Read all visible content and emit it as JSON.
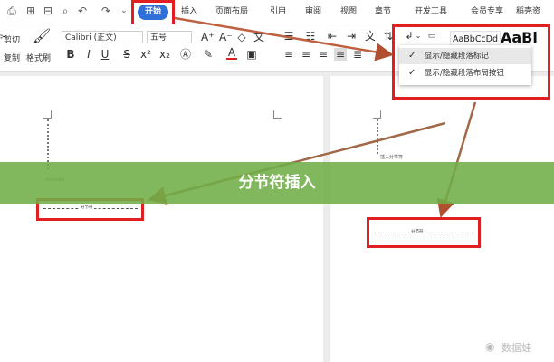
{
  "menu": {
    "home_tab": "开始",
    "tabs": [
      "插入",
      "页面布局",
      "引用",
      "审阅",
      "视图",
      "章节",
      "开发工具",
      "会员专享",
      "稻壳资"
    ]
  },
  "ribbon": {
    "cut": "剪切",
    "copy": "复制",
    "format_painter": "格式刷",
    "font_name": "Calibri (正文)",
    "font_size": "五号",
    "style_preview_1": "AaBbCcDd",
    "style_preview_2": "AaBl"
  },
  "dropdown": {
    "items": [
      "显示/隐藏段落标记",
      "显示/隐藏段落布局按钮"
    ]
  },
  "banner": {
    "title": "分节符插入"
  },
  "document": {
    "left_small_text": "sdsdsdls",
    "left_break_label": "分节符",
    "right_small_text": "插入分节符",
    "right_break_label": "分节符"
  },
  "watermark": {
    "text": "数据蛙"
  },
  "colors": {
    "accent": "#2f6fd8",
    "highlight_box": "#e02020",
    "banner": "#70ad47"
  }
}
